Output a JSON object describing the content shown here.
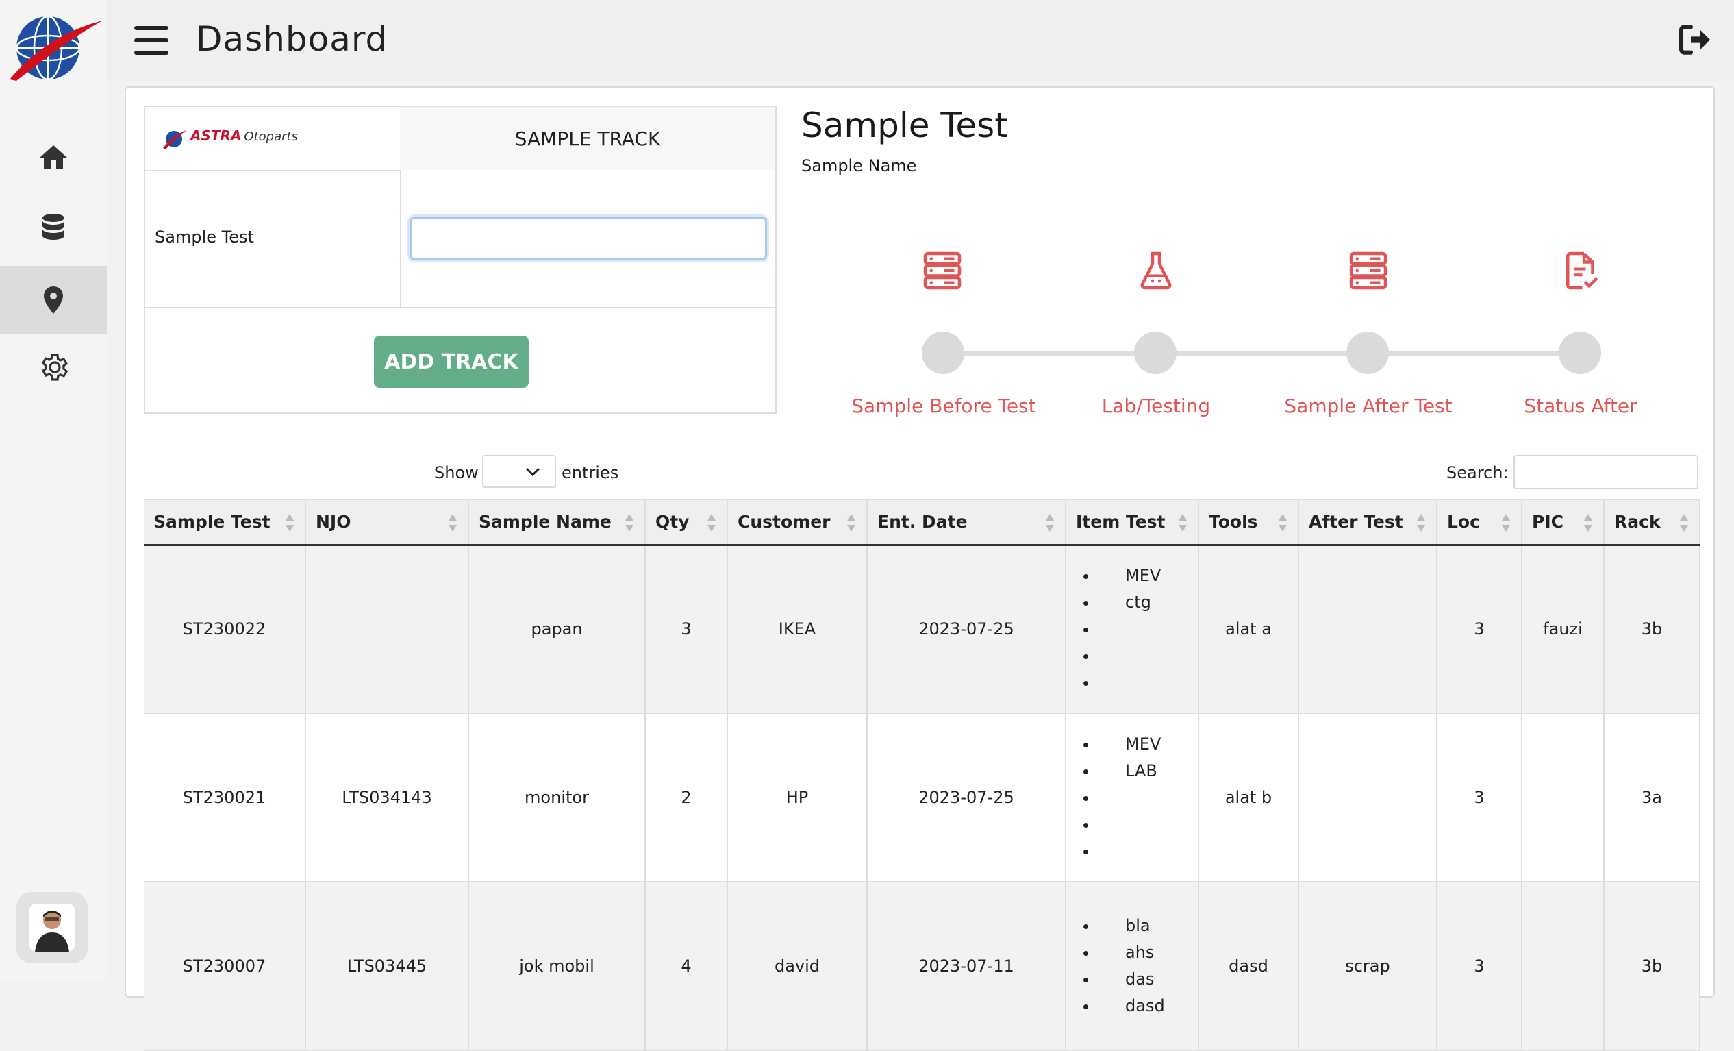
{
  "header": {
    "title": "Dashboard"
  },
  "sidebar": {
    "items": [
      {
        "name": "home",
        "icon": "home-icon"
      },
      {
        "name": "database",
        "icon": "database-icon"
      },
      {
        "name": "location",
        "icon": "map-pin-icon",
        "active": true
      },
      {
        "name": "settings",
        "icon": "gear-icon"
      }
    ]
  },
  "form": {
    "brand": "ASTRA",
    "brand_suffix": "Otoparts",
    "track_header": "SAMPLE TRACK",
    "sample_label": "Sample Test",
    "sample_value": "",
    "add_button": "ADD TRACK"
  },
  "sample_info": {
    "title": "Sample Test",
    "subtitle": "Sample Name"
  },
  "steps": [
    {
      "label": "Sample Before Test",
      "icon": "server-icon"
    },
    {
      "label": "Lab/Testing",
      "icon": "flask-icon"
    },
    {
      "label": "Sample After Test",
      "icon": "server-icon"
    },
    {
      "label": "Status After",
      "icon": "file-check-icon"
    }
  ],
  "colors": {
    "accent": "#e05656",
    "button": "#63ae88",
    "active_nav": "#dcdcdc"
  },
  "table_controls": {
    "show_label": "Show",
    "show_value": "",
    "entries_label": "entries",
    "search_label": "Search:",
    "search_value": ""
  },
  "table": {
    "columns": [
      "Sample Test",
      "NJO",
      "Sample Name",
      "Qty",
      "Customer",
      "Ent. Date",
      "Item Test",
      "Tools",
      "After Test",
      "Loc",
      "PIC",
      "Rack"
    ],
    "rows": [
      {
        "sample_test": "ST230022",
        "njo": "",
        "sample_name": "papan",
        "qty": "3",
        "customer": "IKEA",
        "ent_date": "2023-07-25",
        "items": [
          "MEV",
          "ctg",
          "",
          "",
          ""
        ],
        "tools": "alat a",
        "after_test": "",
        "loc": "3",
        "pic": "fauzi",
        "rack": "3b"
      },
      {
        "sample_test": "ST230021",
        "njo": "LTS034143",
        "sample_name": "monitor",
        "qty": "2",
        "customer": "HP",
        "ent_date": "2023-07-25",
        "items": [
          "MEV",
          "LAB",
          "",
          "",
          ""
        ],
        "tools": "alat b",
        "after_test": "",
        "loc": "3",
        "pic": "",
        "rack": "3a"
      },
      {
        "sample_test": "ST230007",
        "njo": "LTS03445",
        "sample_name": "jok mobil",
        "qty": "4",
        "customer": "david",
        "ent_date": "2023-07-11",
        "items": [
          "bla",
          "ahs",
          "das",
          "dasd"
        ],
        "tools": "dasd",
        "after_test": "scrap",
        "loc": "3",
        "pic": "",
        "rack": "3b"
      }
    ]
  }
}
